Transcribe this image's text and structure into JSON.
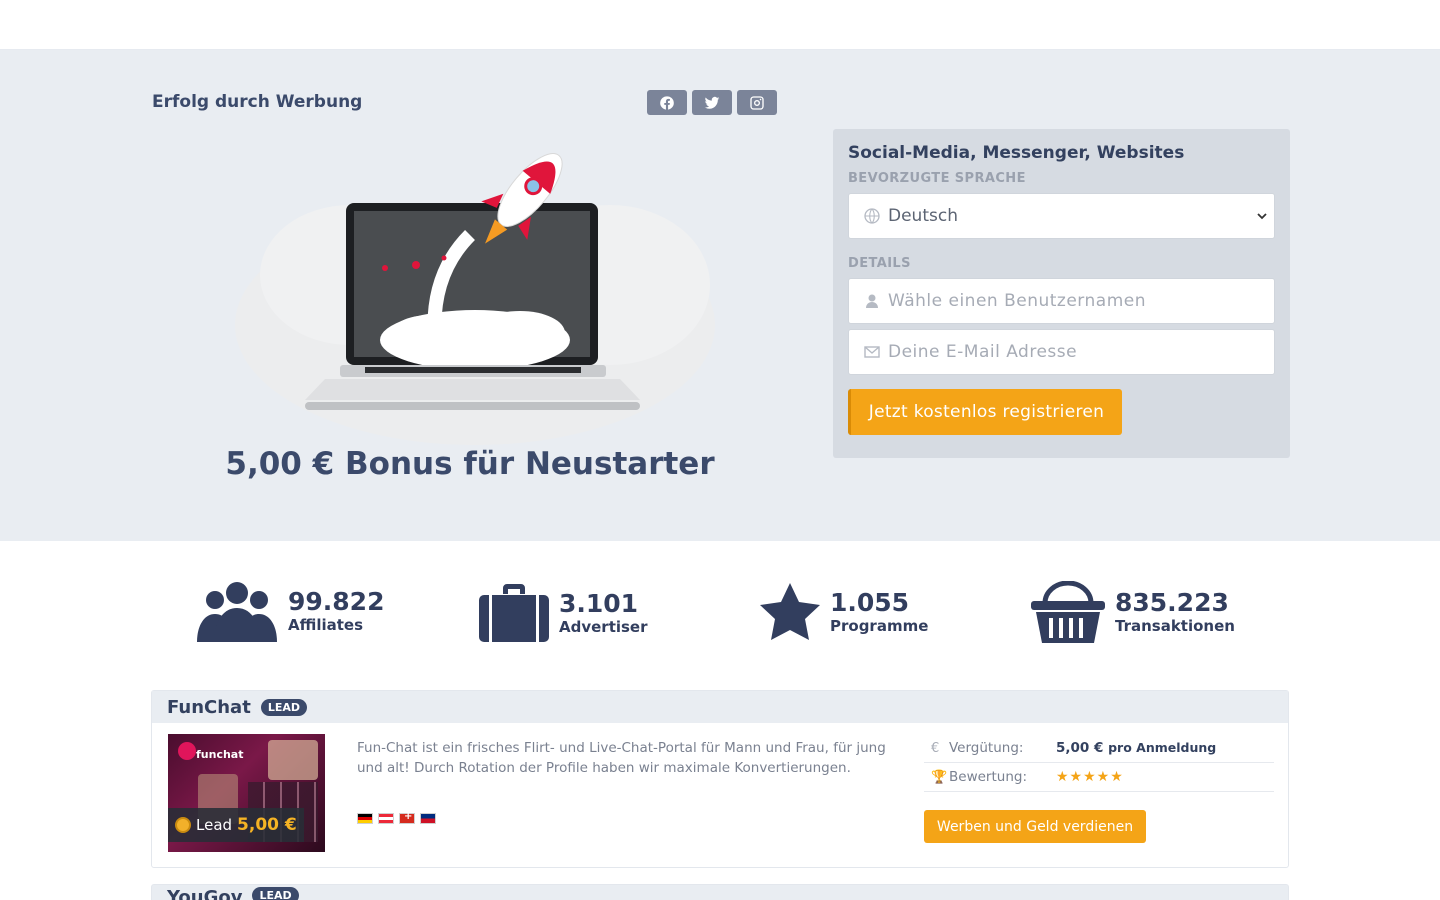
{
  "hero": {
    "title": "Erfolg durch Werbung",
    "bonus": "5,00 € Bonus für Neustarter",
    "social": [
      "facebook-icon",
      "twitter-icon",
      "instagram-icon"
    ]
  },
  "register": {
    "heading": "Social-Media, Messenger, Websites",
    "language_label": "BEVORZUGTE SPRACHE",
    "language_value": "Deutsch",
    "details_label": "DETAILS",
    "username_placeholder": "Wähle einen Benutzernamen",
    "email_placeholder": "Deine E-Mail Adresse",
    "submit_label": "Jetzt kostenlos registrieren"
  },
  "stats": [
    {
      "value": "99.822",
      "label": "Affiliates",
      "icon": "users-icon"
    },
    {
      "value": "3.101",
      "label": "Advertiser",
      "icon": "briefcase-icon"
    },
    {
      "value": "1.055",
      "label": "Programme",
      "icon": "star-icon"
    },
    {
      "value": "835.223",
      "label": "Transaktionen",
      "icon": "basket-icon"
    }
  ],
  "programs": [
    {
      "name": "FunChat",
      "badge": "LEAD",
      "thumb_logo": "funchat",
      "lead_label": "Lead",
      "lead_amount": "5,00 €",
      "description": "Fun-Chat ist ein frisches Flirt- und Live-Chat-Portal für Mann und Frau, für jung und alt! Durch Rotation der Profile haben wir maximale Konvertierungen.",
      "flags": [
        "de",
        "at",
        "ch",
        "li"
      ],
      "compensation_label": "Vergütung:",
      "compensation_value": "5,00 €",
      "compensation_unit": "pro Anmeldung",
      "rating_label": "Bewertung:",
      "rating": 5,
      "rating_stars": "★★★★★",
      "cta": "Werben und Geld verdienen"
    },
    {
      "name": "YouGov",
      "badge": "LEAD"
    }
  ],
  "colors": {
    "accent": "#f4a417",
    "primary_text": "#33415f",
    "hero_bg": "#e9edf2"
  }
}
